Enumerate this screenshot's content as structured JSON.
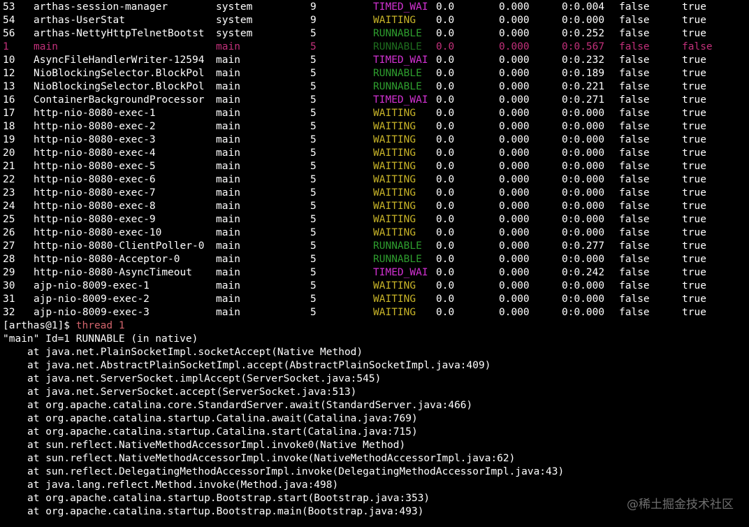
{
  "colors": {
    "background": "#000000",
    "text": "#ffffff",
    "timed_waiting": "#d231d2",
    "waiting": "#c8b428",
    "runnable": "#2e9e2e",
    "highlight_row": "#c2307a",
    "command": "#d2646c"
  },
  "threads": [
    {
      "id": "53",
      "name": "arthas-session-manager",
      "group": "system",
      "priority": "9",
      "state": "TIMED_WAI",
      "cpu": "0.0",
      "delta": "0.000",
      "time": "0:0.004",
      "interrupted": "false",
      "daemon": "true"
    },
    {
      "id": "54",
      "name": "arthas-UserStat",
      "group": "system",
      "priority": "9",
      "state": "WAITING",
      "cpu": "0.0",
      "delta": "0.000",
      "time": "0:0.000",
      "interrupted": "false",
      "daemon": "true"
    },
    {
      "id": "56",
      "name": "arthas-NettyHttpTelnetBootst",
      "group": "system",
      "priority": "5",
      "state": "RUNNABLE",
      "cpu": "0.0",
      "delta": "0.000",
      "time": "0:0.252",
      "interrupted": "false",
      "daemon": "true"
    },
    {
      "id": "1",
      "name": "main",
      "group": "main",
      "priority": "5",
      "state": "RUNNABLE",
      "cpu": "0.0",
      "delta": "0.000",
      "time": "0:0.567",
      "interrupted": "false",
      "daemon": "false",
      "highlighted": true
    },
    {
      "id": "10",
      "name": "AsyncFileHandlerWriter-12594",
      "group": "main",
      "priority": "5",
      "state": "TIMED_WAI",
      "cpu": "0.0",
      "delta": "0.000",
      "time": "0:0.232",
      "interrupted": "false",
      "daemon": "true"
    },
    {
      "id": "12",
      "name": "NioBlockingSelector.BlockPol",
      "group": "main",
      "priority": "5",
      "state": "RUNNABLE",
      "cpu": "0.0",
      "delta": "0.000",
      "time": "0:0.189",
      "interrupted": "false",
      "daemon": "true"
    },
    {
      "id": "13",
      "name": "NioBlockingSelector.BlockPol",
      "group": "main",
      "priority": "5",
      "state": "RUNNABLE",
      "cpu": "0.0",
      "delta": "0.000",
      "time": "0:0.221",
      "interrupted": "false",
      "daemon": "true"
    },
    {
      "id": "16",
      "name": "ContainerBackgroundProcessor",
      "group": "main",
      "priority": "5",
      "state": "TIMED_WAI",
      "cpu": "0.0",
      "delta": "0.000",
      "time": "0:0.271",
      "interrupted": "false",
      "daemon": "true"
    },
    {
      "id": "17",
      "name": "http-nio-8080-exec-1",
      "group": "main",
      "priority": "5",
      "state": "WAITING",
      "cpu": "0.0",
      "delta": "0.000",
      "time": "0:0.000",
      "interrupted": "false",
      "daemon": "true"
    },
    {
      "id": "18",
      "name": "http-nio-8080-exec-2",
      "group": "main",
      "priority": "5",
      "state": "WAITING",
      "cpu": "0.0",
      "delta": "0.000",
      "time": "0:0.000",
      "interrupted": "false",
      "daemon": "true"
    },
    {
      "id": "19",
      "name": "http-nio-8080-exec-3",
      "group": "main",
      "priority": "5",
      "state": "WAITING",
      "cpu": "0.0",
      "delta": "0.000",
      "time": "0:0.000",
      "interrupted": "false",
      "daemon": "true"
    },
    {
      "id": "20",
      "name": "http-nio-8080-exec-4",
      "group": "main",
      "priority": "5",
      "state": "WAITING",
      "cpu": "0.0",
      "delta": "0.000",
      "time": "0:0.000",
      "interrupted": "false",
      "daemon": "true"
    },
    {
      "id": "21",
      "name": "http-nio-8080-exec-5",
      "group": "main",
      "priority": "5",
      "state": "WAITING",
      "cpu": "0.0",
      "delta": "0.000",
      "time": "0:0.000",
      "interrupted": "false",
      "daemon": "true"
    },
    {
      "id": "22",
      "name": "http-nio-8080-exec-6",
      "group": "main",
      "priority": "5",
      "state": "WAITING",
      "cpu": "0.0",
      "delta": "0.000",
      "time": "0:0.000",
      "interrupted": "false",
      "daemon": "true"
    },
    {
      "id": "23",
      "name": "http-nio-8080-exec-7",
      "group": "main",
      "priority": "5",
      "state": "WAITING",
      "cpu": "0.0",
      "delta": "0.000",
      "time": "0:0.000",
      "interrupted": "false",
      "daemon": "true"
    },
    {
      "id": "24",
      "name": "http-nio-8080-exec-8",
      "group": "main",
      "priority": "5",
      "state": "WAITING",
      "cpu": "0.0",
      "delta": "0.000",
      "time": "0:0.000",
      "interrupted": "false",
      "daemon": "true"
    },
    {
      "id": "25",
      "name": "http-nio-8080-exec-9",
      "group": "main",
      "priority": "5",
      "state": "WAITING",
      "cpu": "0.0",
      "delta": "0.000",
      "time": "0:0.000",
      "interrupted": "false",
      "daemon": "true"
    },
    {
      "id": "26",
      "name": "http-nio-8080-exec-10",
      "group": "main",
      "priority": "5",
      "state": "WAITING",
      "cpu": "0.0",
      "delta": "0.000",
      "time": "0:0.000",
      "interrupted": "false",
      "daemon": "true"
    },
    {
      "id": "27",
      "name": "http-nio-8080-ClientPoller-0",
      "group": "main",
      "priority": "5",
      "state": "RUNNABLE",
      "cpu": "0.0",
      "delta": "0.000",
      "time": "0:0.277",
      "interrupted": "false",
      "daemon": "true"
    },
    {
      "id": "28",
      "name": "http-nio-8080-Acceptor-0",
      "group": "main",
      "priority": "5",
      "state": "RUNNABLE",
      "cpu": "0.0",
      "delta": "0.000",
      "time": "0:0.000",
      "interrupted": "false",
      "daemon": "true"
    },
    {
      "id": "29",
      "name": "http-nio-8080-AsyncTimeout",
      "group": "main",
      "priority": "5",
      "state": "TIMED_WAI",
      "cpu": "0.0",
      "delta": "0.000",
      "time": "0:0.242",
      "interrupted": "false",
      "daemon": "true"
    },
    {
      "id": "30",
      "name": "ajp-nio-8009-exec-1",
      "group": "main",
      "priority": "5",
      "state": "WAITING",
      "cpu": "0.0",
      "delta": "0.000",
      "time": "0:0.000",
      "interrupted": "false",
      "daemon": "true"
    },
    {
      "id": "31",
      "name": "ajp-nio-8009-exec-2",
      "group": "main",
      "priority": "5",
      "state": "WAITING",
      "cpu": "0.0",
      "delta": "0.000",
      "time": "0:0.000",
      "interrupted": "false",
      "daemon": "true"
    },
    {
      "id": "32",
      "name": "ajp-nio-8009-exec-3",
      "group": "main",
      "priority": "5",
      "state": "WAITING",
      "cpu": "0.0",
      "delta": "0.000",
      "time": "0:0.000",
      "interrupted": "false",
      "daemon": "true"
    }
  ],
  "prompt": {
    "text": "[arthas@1]$ ",
    "command": "thread 1"
  },
  "thread_header": "\"main\" Id=1 RUNNABLE (in native)",
  "stack_frames": [
    "at java.net.PlainSocketImpl.socketAccept(Native Method)",
    "at java.net.AbstractPlainSocketImpl.accept(AbstractPlainSocketImpl.java:409)",
    "at java.net.ServerSocket.implAccept(ServerSocket.java:545)",
    "at java.net.ServerSocket.accept(ServerSocket.java:513)",
    "at org.apache.catalina.core.StandardServer.await(StandardServer.java:466)",
    "at org.apache.catalina.startup.Catalina.await(Catalina.java:769)",
    "at org.apache.catalina.startup.Catalina.start(Catalina.java:715)",
    "at sun.reflect.NativeMethodAccessorImpl.invoke0(Native Method)",
    "at sun.reflect.NativeMethodAccessorImpl.invoke(NativeMethodAccessorImpl.java:62)",
    "at sun.reflect.DelegatingMethodAccessorImpl.invoke(DelegatingMethodAccessorImpl.java:43)",
    "at java.lang.reflect.Method.invoke(Method.java:498)",
    "at org.apache.catalina.startup.Bootstrap.start(Bootstrap.java:353)",
    "at org.apache.catalina.startup.Bootstrap.main(Bootstrap.java:493)"
  ],
  "watermark": "@稀土掘金技术社区"
}
